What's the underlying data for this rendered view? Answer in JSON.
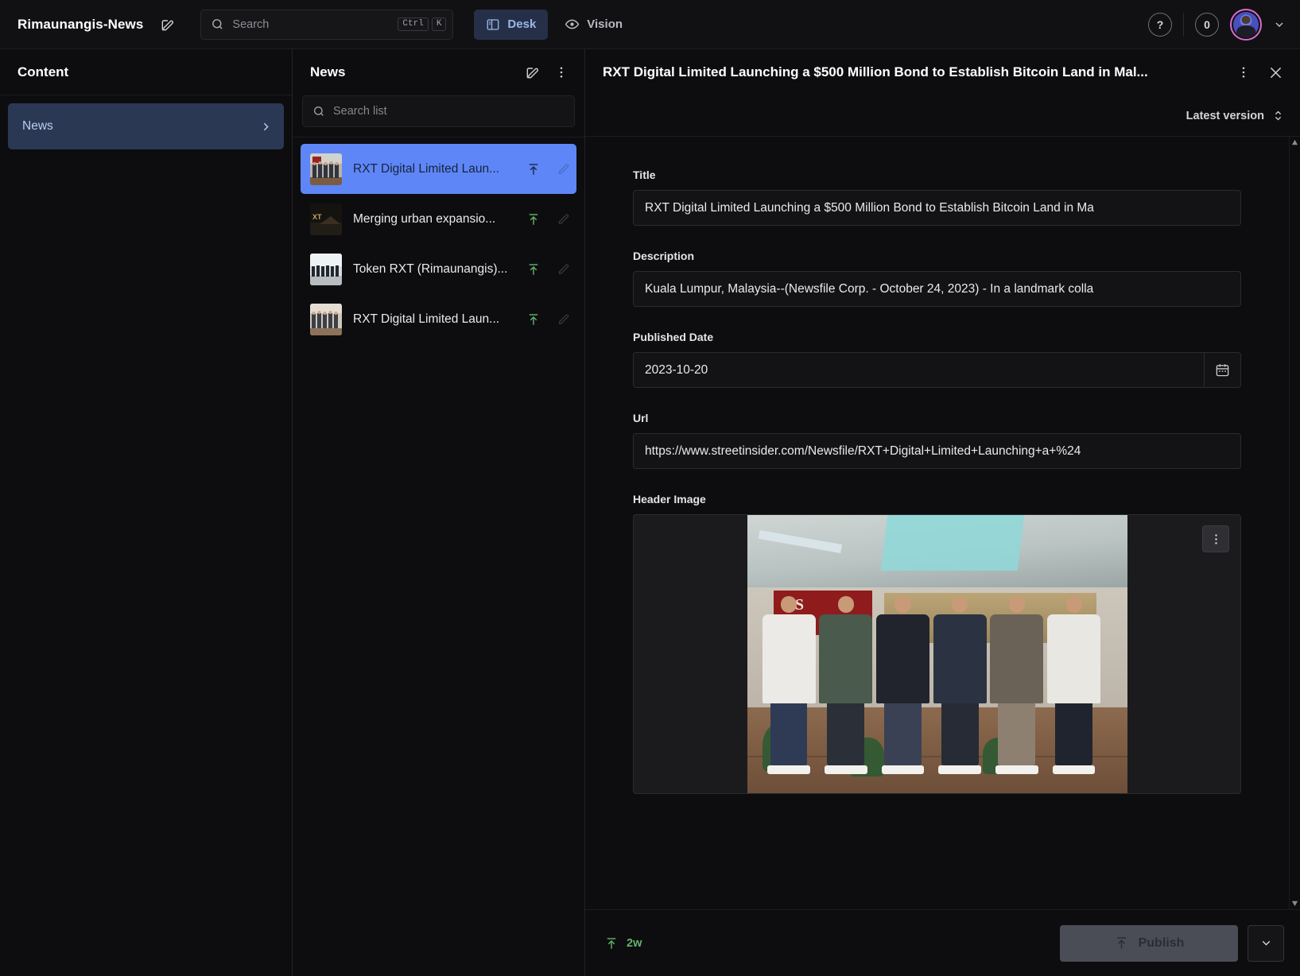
{
  "header": {
    "brand": "Rimaunangis-News",
    "compose_icon": "compose-icon",
    "search": {
      "placeholder": "Search",
      "kbd_mod": "Ctrl",
      "kbd_key": "K"
    },
    "tabs": [
      {
        "label": "Desk",
        "icon": "desk-icon",
        "active": true
      },
      {
        "label": "Vision",
        "icon": "eye-icon",
        "active": false
      }
    ],
    "help_icon": "question-mark-icon",
    "notification_count": "0",
    "avatar": "user-avatar",
    "chevron": "chevron-down-icon",
    "accent": "#5e86f7",
    "avatar_ring": "#d96bd0"
  },
  "content_pane": {
    "title": "Content",
    "items": [
      {
        "label": "News",
        "selected": true,
        "chevron": "chevron-right-icon"
      }
    ]
  },
  "list_pane": {
    "title": "News",
    "compose_icon": "compose-icon",
    "more_icon": "more-vertical-icon",
    "search": {
      "placeholder": "Search list"
    },
    "items": [
      {
        "title": "RXT Digital Limited Laun...",
        "selected": true,
        "publish_icon": "publish-arrow-icon",
        "edit_icon": "pencil-icon"
      },
      {
        "title": "Merging urban expansio...",
        "selected": false,
        "publish_icon": "publish-arrow-icon",
        "edit_icon": "pencil-icon"
      },
      {
        "title": "Token RXT (Rimaunangis)...",
        "selected": false,
        "publish_icon": "publish-arrow-icon",
        "edit_icon": "pencil-icon"
      },
      {
        "title": "RXT Digital Limited Laun...",
        "selected": false,
        "publish_icon": "publish-arrow-icon",
        "edit_icon": "pencil-icon"
      }
    ]
  },
  "document": {
    "title": "RXT Digital Limited Launching a $500 Million Bond to Establish Bitcoin Land in Mal...",
    "more_icon": "more-vertical-icon",
    "close_icon": "close-icon",
    "version_label": "Latest version",
    "version_icon": "chevron-up-down-icon",
    "fields": {
      "title": {
        "label": "Title",
        "value": "RXT Digital Limited Launching a $500 Million Bond to Establish Bitcoin Land in Ma"
      },
      "description": {
        "label": "Description",
        "value": "Kuala Lumpur, Malaysia--(Newsfile Corp. - October 24, 2023) - In a landmark colla"
      },
      "published_date": {
        "label": "Published Date",
        "value": "2023-10-20",
        "calendar_icon": "calendar-icon"
      },
      "url": {
        "label": "Url",
        "value": "https://www.streetinsider.com/Newsfile/RXT+Digital+Limited+Launching+a+%24"
      },
      "header_image": {
        "label": "Header Image",
        "menu_icon": "more-vertical-icon",
        "alt": "group-photo-six-men-standing"
      }
    },
    "footer": {
      "time_ago": "2w",
      "time_icon": "publish-arrow-icon",
      "publish_label": "Publish",
      "publish_icon": "publish-arrow-icon",
      "publish_caret": "chevron-down-icon"
    }
  }
}
